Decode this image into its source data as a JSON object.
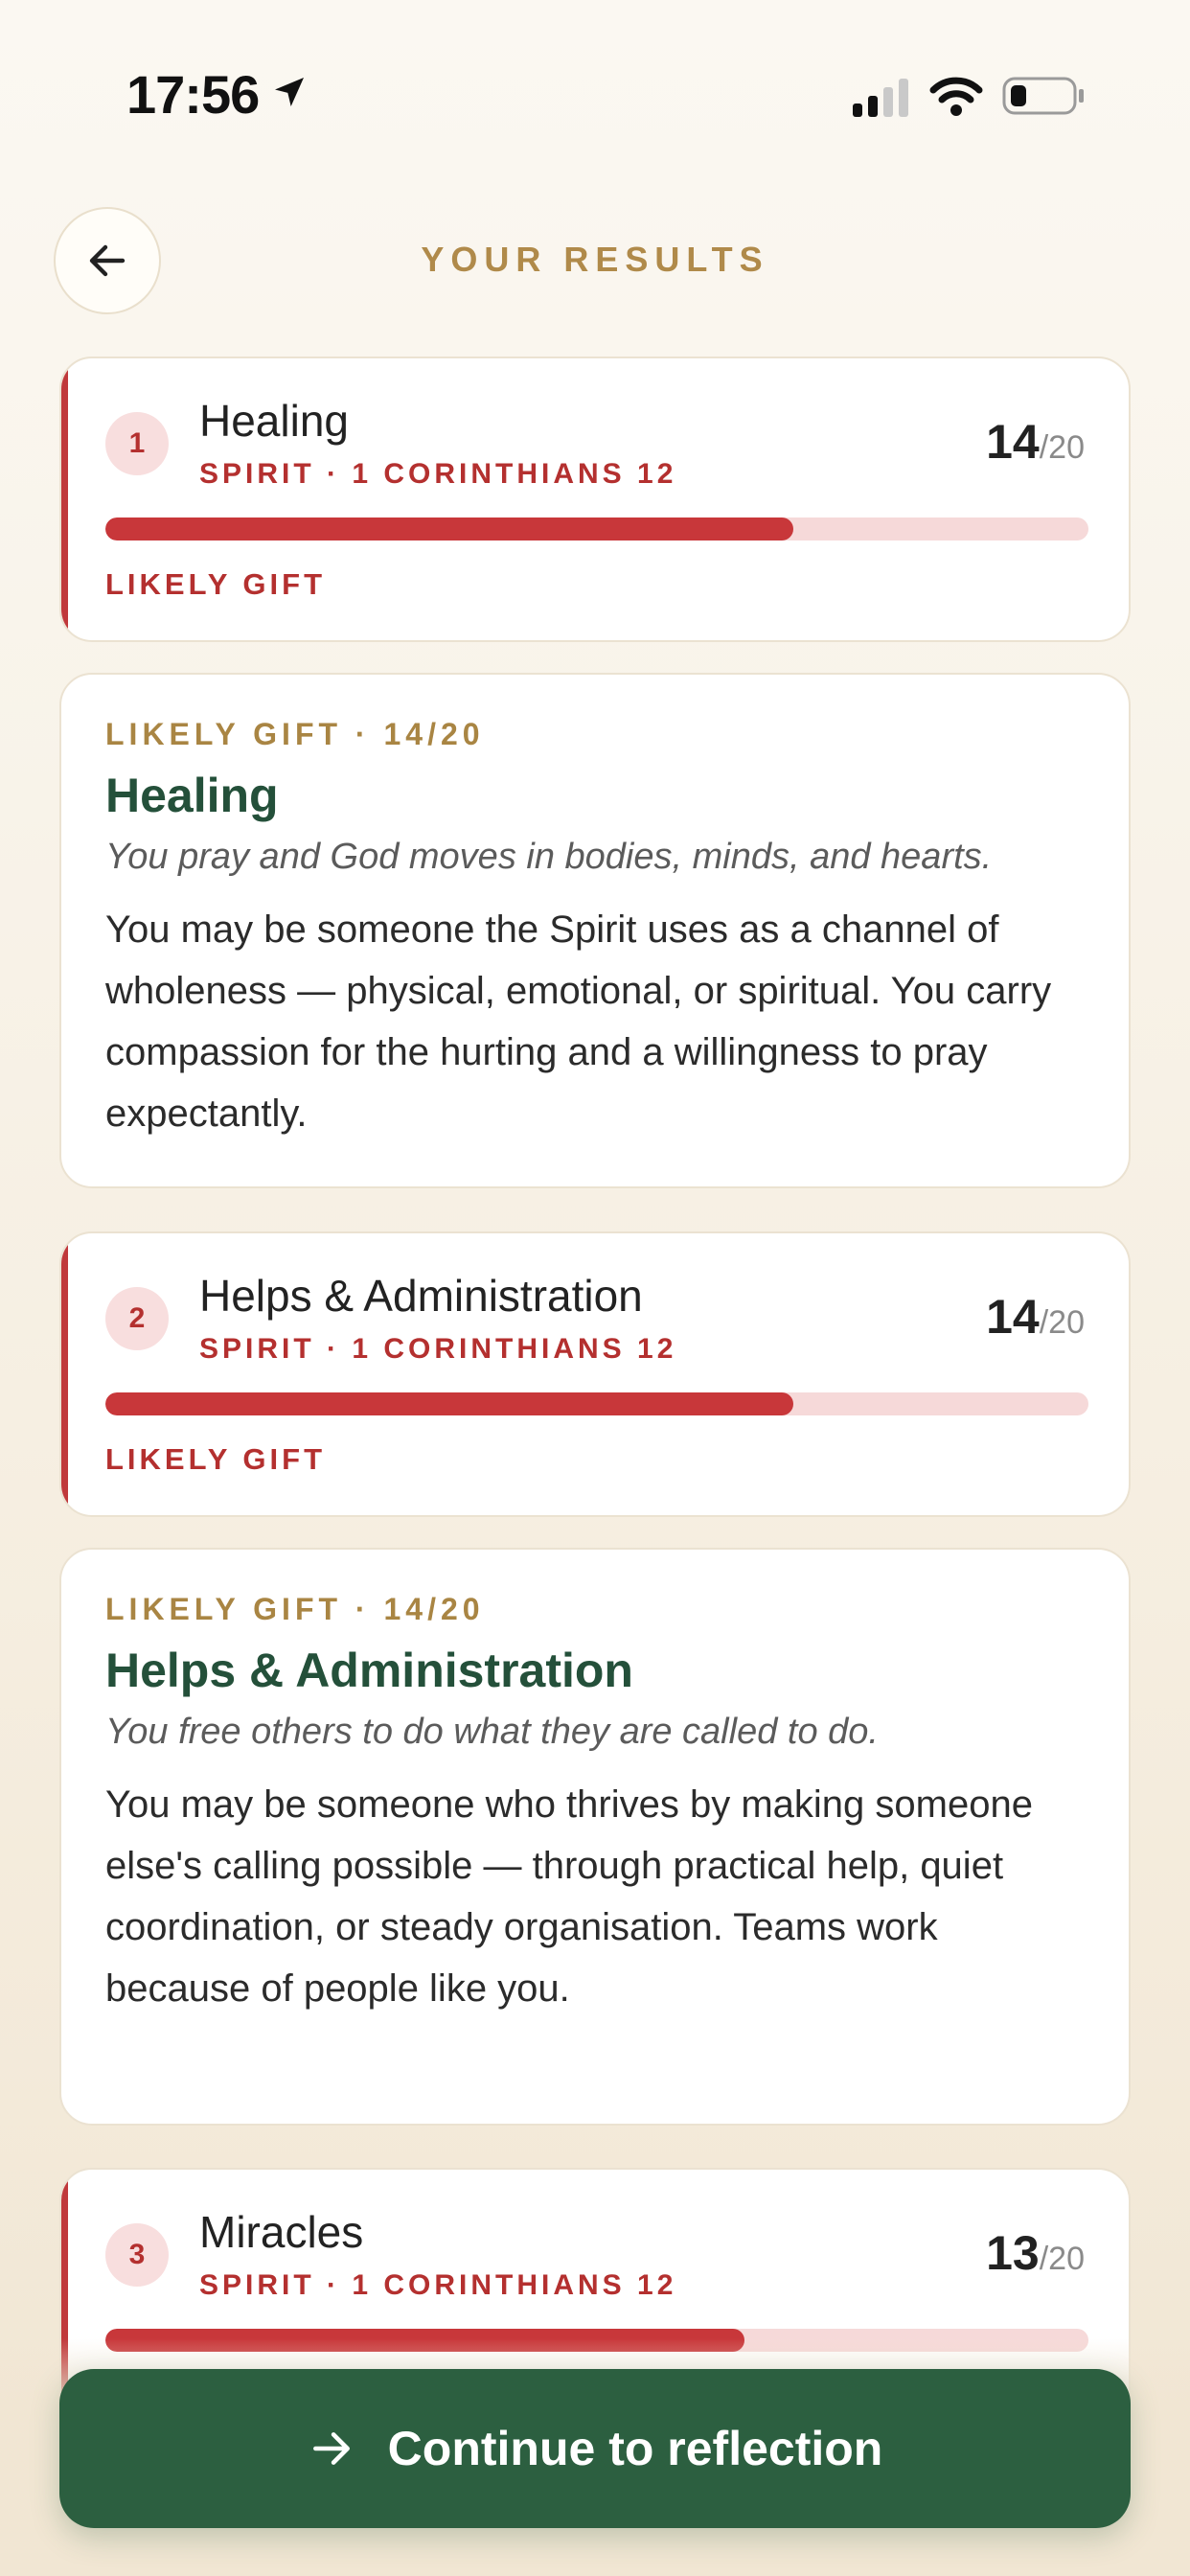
{
  "status_bar": {
    "time": "17:56",
    "signal_bars": 2,
    "battery_level": 0.2
  },
  "header": {
    "title": "YOUR RESULTS",
    "back_icon": "arrow-left-icon"
  },
  "results": [
    {
      "rank": "1",
      "name": "Healing",
      "ref": "SPIRIT · 1 CORINTHIANS 12",
      "score": "14",
      "max": "/20",
      "fraction": 0.7,
      "badge": "LIKELY GIFT",
      "detail": {
        "eyebrow": "LIKELY GIFT · 14/20",
        "title": "Healing",
        "tagline": "You pray and God moves in bodies, minds, and hearts.",
        "body": "You may be someone the Spirit uses as a channel of wholeness — physical, emotional, or spiritual. You carry compassion for the hurting and a willingness to pray expectantly."
      }
    },
    {
      "rank": "2",
      "name": "Helps & Administration",
      "ref": "SPIRIT · 1 CORINTHIANS 12",
      "score": "14",
      "max": "/20",
      "fraction": 0.7,
      "badge": "LIKELY GIFT",
      "detail": {
        "eyebrow": "LIKELY GIFT · 14/20",
        "title": "Helps & Administration",
        "tagline": "You free others to do what they are called to do.",
        "body": "You may be someone who thrives by making someone else's calling possible — through practical help, quiet coordination, or steady organisation. Teams work because of people like you."
      }
    },
    {
      "rank": "3",
      "name": "Miracles",
      "ref": "SPIRIT · 1 CORINTHIANS 12",
      "score": "13",
      "max": "/20",
      "fraction": 0.65
    }
  ],
  "cta": {
    "label": "Continue to reflection",
    "icon": "arrow-right-icon"
  },
  "colors": {
    "accent_red": "#c8373a",
    "brand_green": "#2c5f40",
    "gold": "#b08a4a"
  }
}
